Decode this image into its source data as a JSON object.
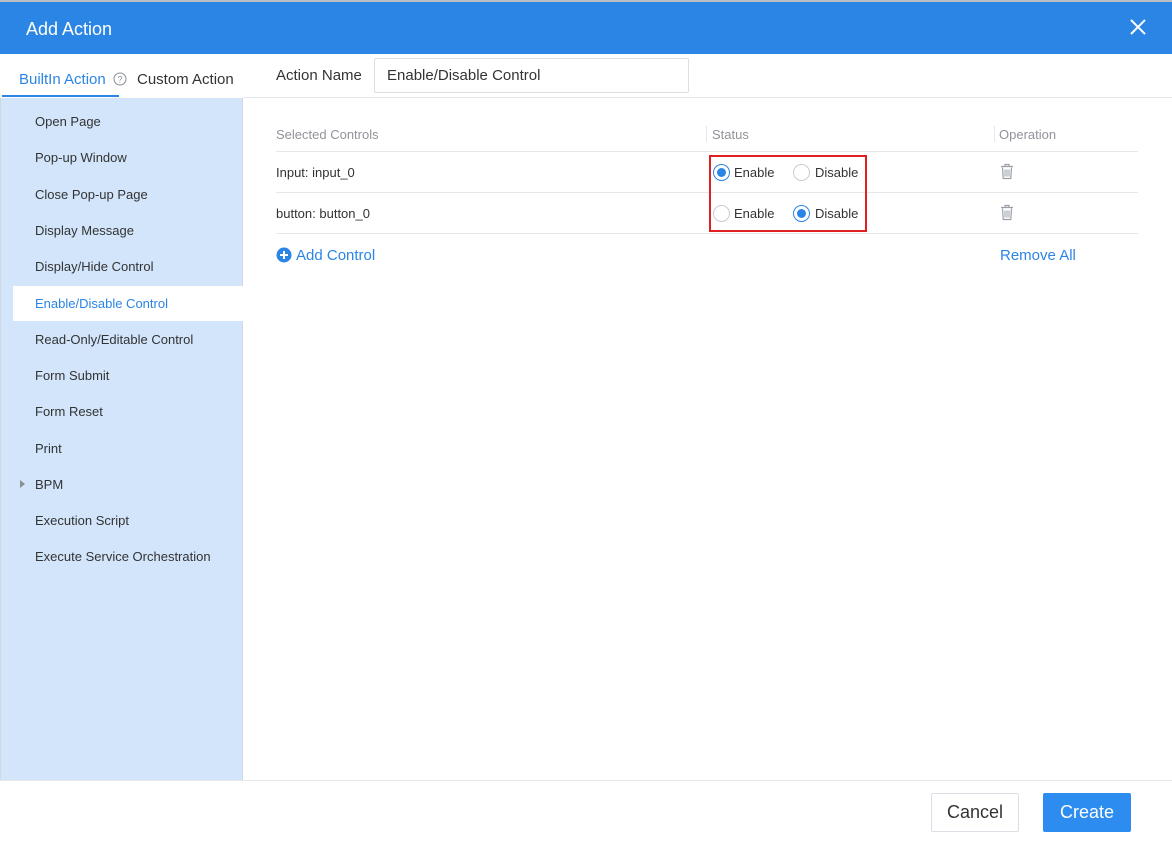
{
  "dialog": {
    "title": "Add Action"
  },
  "tabs": {
    "builtin_label": "BuiltIn Action",
    "custom_label": "Custom Action"
  },
  "sidebar": {
    "items": [
      {
        "label": "Open Page"
      },
      {
        "label": "Pop-up Window"
      },
      {
        "label": "Close Pop-up Page"
      },
      {
        "label": "Display Message"
      },
      {
        "label": "Display/Hide Control"
      },
      {
        "label": "Enable/Disable Control",
        "selected": true
      },
      {
        "label": "Read-Only/Editable Control"
      },
      {
        "label": "Form Submit"
      },
      {
        "label": "Form Reset"
      },
      {
        "label": "Print"
      },
      {
        "label": "BPM",
        "expandable": true
      },
      {
        "label": "Execution Script"
      },
      {
        "label": "Execute Service Orchestration"
      }
    ]
  },
  "action_name": {
    "label": "Action Name",
    "value": "Enable/Disable Control"
  },
  "grid": {
    "columns": [
      "Selected Controls",
      "Status",
      "Operation"
    ],
    "rows": [
      {
        "control": "Input: input_0",
        "enable_label": "Enable",
        "disable_label": "Disable",
        "status": "Enable"
      },
      {
        "control": "button: button_0",
        "enable_label": "Enable",
        "disable_label": "Disable",
        "status": "Disable"
      }
    ]
  },
  "links": {
    "add_control": "Add Control",
    "remove_all": "Remove All"
  },
  "footer": {
    "cancel_label": "Cancel",
    "create_label": "Create"
  },
  "colors": {
    "accent": "#2b85e4",
    "sidebar_bg": "#d2e5fb",
    "highlight": "#e02020"
  },
  "icons": {
    "close": "close-icon",
    "help": "help-circle-icon",
    "delete": "trash-icon",
    "add": "plus-circle-icon",
    "expand": "caret-right-icon"
  }
}
